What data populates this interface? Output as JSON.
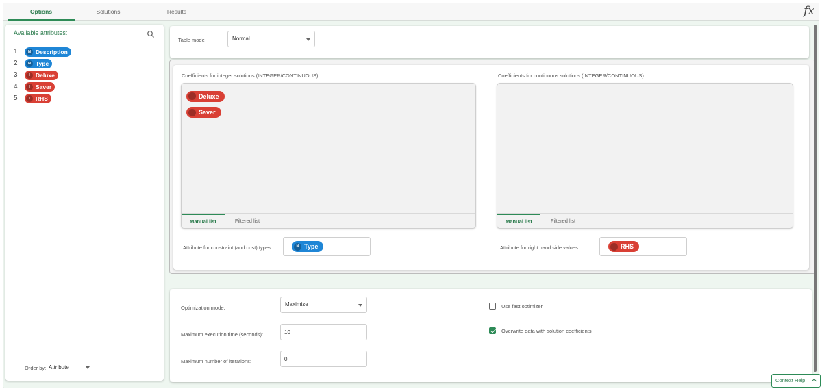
{
  "tabs": [
    {
      "label": "Options",
      "active": true
    },
    {
      "label": "Solutions",
      "active": false
    },
    {
      "label": "Results",
      "active": false
    }
  ],
  "fx_label": "fx",
  "attributes_panel": {
    "title": "Available attributes:",
    "items": [
      {
        "index": "1",
        "type": "N",
        "name": "Description",
        "kind": "nominal"
      },
      {
        "index": "2",
        "type": "N",
        "name": "Type",
        "kind": "nominal"
      },
      {
        "index": "3",
        "type": "I",
        "name": "Deluxe",
        "kind": "integer"
      },
      {
        "index": "4",
        "type": "I",
        "name": "Saver",
        "kind": "integer"
      },
      {
        "index": "5",
        "type": "I",
        "name": "RHS",
        "kind": "integer"
      }
    ],
    "order_by_label": "Order by:",
    "order_by_value": "Attribute"
  },
  "table_mode": {
    "label": "Table mode",
    "value": "Normal"
  },
  "integer_box": {
    "label": "Coefficients for integer solutions (INTEGER/CONTINUOUS):",
    "chips": [
      {
        "type": "I",
        "name": "Deluxe"
      },
      {
        "type": "I",
        "name": "Saver"
      }
    ],
    "tab_manual": "Manual list",
    "tab_filtered": "Filtered list"
  },
  "continuous_box": {
    "label": "Coefficients for continuous solutions (INTEGER/CONTINUOUS):",
    "tab_manual": "Manual list",
    "tab_filtered": "Filtered list"
  },
  "constraint_attr": {
    "label": "Attribute for constraint (and cost) types:",
    "type": "N",
    "name": "Type"
  },
  "rhs_attr": {
    "label": "Attribute for right hand side values:",
    "type": "I",
    "name": "RHS"
  },
  "optimization": {
    "mode_label": "Optimization mode:",
    "mode_value": "Maximize",
    "time_label": "Maximum execution time (seconds):",
    "time_value": "10",
    "iter_label": "Maximum number of iterations:",
    "iter_value": "0",
    "fast_label": "Use fast optimizer",
    "fast_checked": false,
    "overwrite_label": "Overwrite data with solution coefficients",
    "overwrite_checked": true
  },
  "context_help": "Context Help",
  "colors": {
    "accent": "#2e8b57",
    "nominal": "#1f86d6",
    "integer": "#d94035"
  }
}
